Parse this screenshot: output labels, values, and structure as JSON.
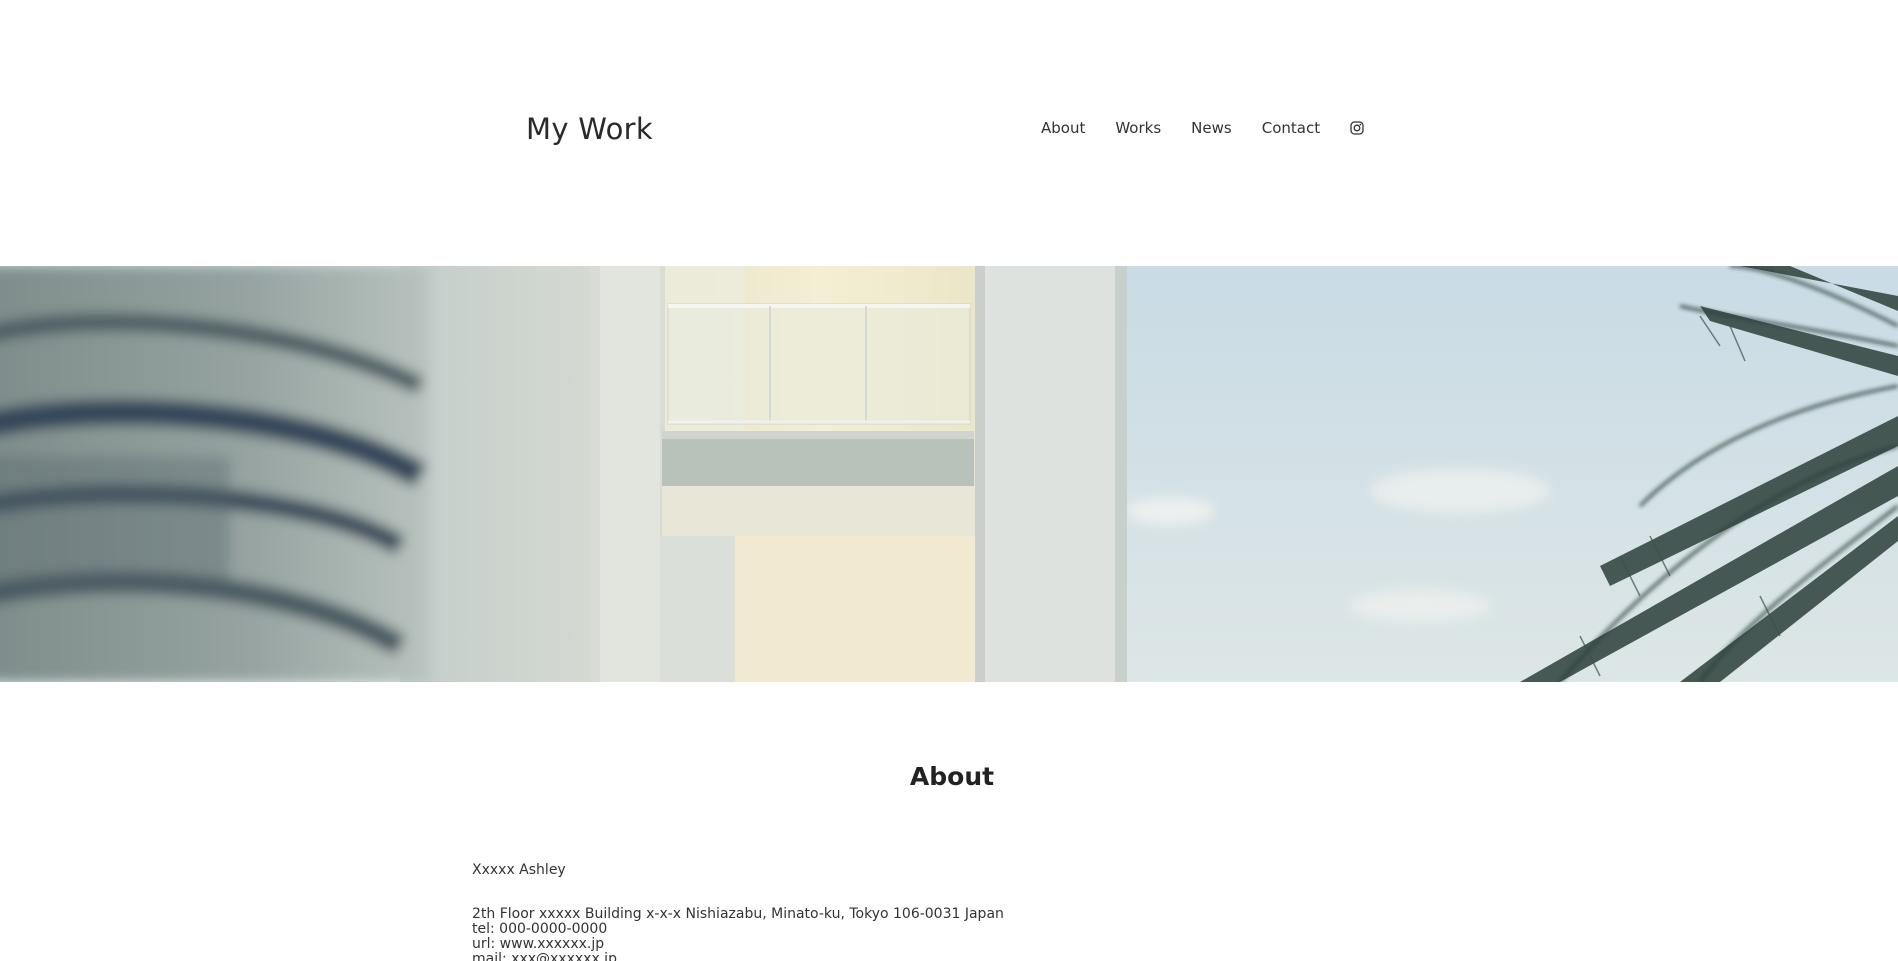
{
  "header": {
    "site_title": "My Work",
    "nav": [
      {
        "label": "About"
      },
      {
        "label": "Works"
      },
      {
        "label": "News"
      },
      {
        "label": "Contact"
      }
    ],
    "social_icon": "instagram-icon"
  },
  "hero": {
    "image": "building-and-palm-photo"
  },
  "about": {
    "heading": "About",
    "name": "Xxxxx Ashley",
    "address": "2th Floor xxxxx Building x-x-x Nishiazabu, Minato-ku, Tokyo 106-0031 Japan",
    "tel": "tel: 000-0000-0000",
    "url": "url: www.xxxxxx.jp",
    "mail": "mail: xxx@xxxxxx.jp"
  }
}
